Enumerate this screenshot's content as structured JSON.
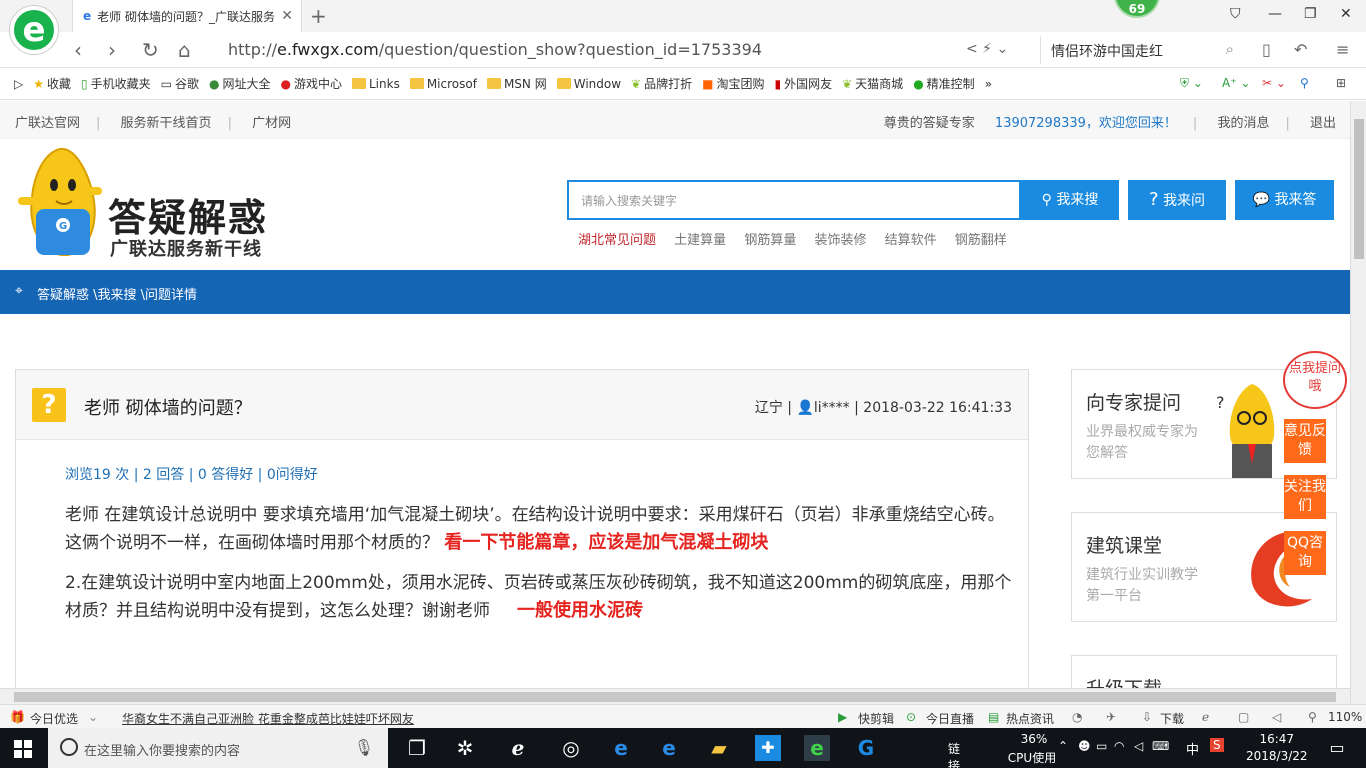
{
  "browser": {
    "tab_title": "老师 砌体墙的问题？_广联达服务",
    "badge": "69",
    "url_prefix": "http://",
    "url_host": "e.fwxgx.com",
    "url_path": "/question/question_show?question_id=1753394",
    "search_text": "情侣环游中国走红",
    "bookmarks": [
      "收藏",
      "手机收藏夹",
      "谷歌",
      "网址大全",
      "游戏中心",
      "Links",
      "Microsof",
      "MSN 网",
      "Window",
      "品牌打折",
      "淘宝团购",
      "外国网友",
      "天猫商城",
      "精准控制"
    ]
  },
  "topnav": {
    "left": [
      "广联达官网",
      "服务新干线首页",
      "广材网"
    ],
    "expert": "尊贵的答疑专家",
    "welcome": "13907298339，欢迎您回来！",
    "messages": "我的消息",
    "logout": "退出"
  },
  "header": {
    "brand_title": "答疑解惑",
    "brand_subtitle": "广联达服务新干线",
    "search_placeholder": "请输入搜索关键字",
    "btn_search": "我来搜",
    "btn_ask": "我来问",
    "btn_answer": "我来答",
    "hot_links": [
      "湖北常见问题",
      "土建算量",
      "钢筋算量",
      "装饰装修",
      "结算软件",
      "钢筋翻样"
    ]
  },
  "breadcrumb": "答疑解惑 \\我来搜 \\问题详情",
  "question": {
    "title": "老师 砌体墙的问题？",
    "region": "辽宁",
    "user": "li****",
    "datetime": "2018-03-22 16:41:33",
    "stats": "浏览19 次 | 2 回答 | 0 答得好 | 0问得好",
    "p1": "老师  在建筑设计总说明中  要求填充墙用‘加气混凝土砌块’。在结构设计说明中要求：采用煤矸石（页岩）非承重烧结空心砖。这俩个说明不一样，在画砌体墙时用那个材质的？",
    "p1_answer": "看一下节能篇章，应该是加气混凝土砌块",
    "p2": "2.在建筑设计说明中室内地面上200mm处，须用水泥砖、页岩砖或蒸压灰砂砖砌筑，我不知道这200mm的砌筑底座，用那个材质？并且结构说明中没有提到，这怎么处理？谢谢老师",
    "p2_answer": "一般使用水泥砖"
  },
  "side": {
    "bubble": "点我提问哦",
    "panel1_title": "向专家提问",
    "panel1_sub": "业界最权威专家为您解答",
    "panel2_title": "建筑课堂",
    "panel2_sub": "建筑行业实训教学第一平台",
    "panel3_title": "升级下载",
    "btn_feedback": "意见反馈",
    "btn_follow": "关注我们",
    "btn_qq": "QQ咨询"
  },
  "statusbar": {
    "today": "今日优选",
    "news": "华裔女生不满自己亚洲脸 花重金整成芭比娃娃吓坏网友",
    "kuaijian": "快剪辑",
    "live": "今日直播",
    "hotnews": "热点资讯",
    "download": "下载",
    "zoom": "110%"
  },
  "taskbar": {
    "search_placeholder": "在这里输入你要搜索的内容",
    "link": "链接",
    "cpu": "36%",
    "cpu_label": "CPU使用",
    "ime": "中",
    "time": "16:47",
    "date": "2018/3/22"
  },
  "colors": {
    "accent_blue": "#1a8be0",
    "breadcrumb_bg": "#1565b5",
    "answer_red": "#e52420",
    "side_orange": "#ff6a1a"
  }
}
